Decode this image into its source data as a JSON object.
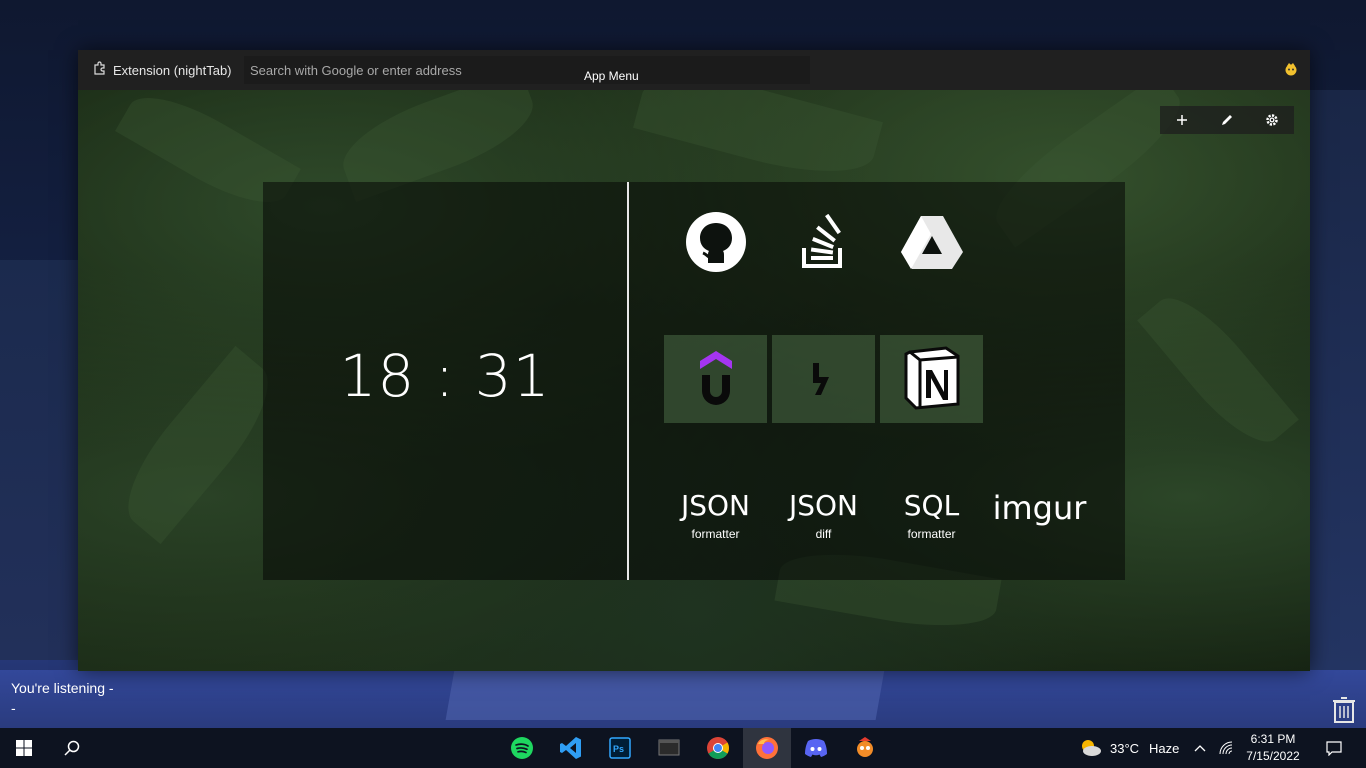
{
  "browser": {
    "extension_label": "Extension (nightTab)",
    "address_placeholder": "Search with Google or enter address",
    "app_menu": "App Menu"
  },
  "page": {
    "clock": "18 : 31",
    "top_menu": [
      "add-icon",
      "edit-icon",
      "settings-icon"
    ],
    "bookmarks_icons": [
      "github-icon",
      "stackoverflow-icon",
      "google-drive-icon"
    ],
    "bookmarks_tiles": [
      "udemy-icon",
      "hashnode-icon",
      "notion-icon"
    ],
    "text_tiles": [
      {
        "main": "JSON",
        "sub": "formatter"
      },
      {
        "main": "JSON",
        "sub": "diff"
      },
      {
        "main": "SQL",
        "sub": "formatter"
      },
      {
        "main": "imgur",
        "sub": ""
      }
    ]
  },
  "desktop": {
    "now_playing": "You're listening -",
    "now_playing_sub": "-"
  },
  "taskbar": {
    "apps": [
      "spotify-icon",
      "vscode-icon",
      "photoshop-icon",
      "terminal-icon",
      "chrome-icon",
      "firefox-icon",
      "discord-icon",
      "app-icon"
    ],
    "weather_temp": "33°C",
    "weather_desc": "Haze",
    "time": "6:31 PM",
    "date": "7/15/2022"
  },
  "colors": {
    "accent_udemy": "#a435f0",
    "taskbar": "#0d1320"
  }
}
